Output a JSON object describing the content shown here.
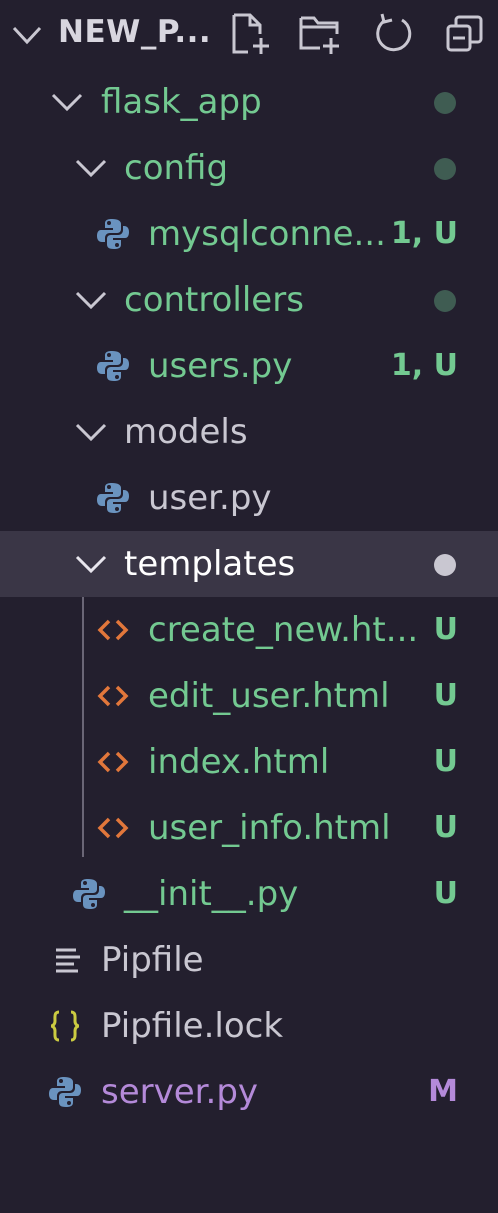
{
  "header": {
    "title": "NEW_P...",
    "actions": [
      "new-file-icon",
      "new-folder-icon",
      "refresh-icon",
      "collapse-all-icon"
    ]
  },
  "colors": {
    "untracked": "#73c991",
    "modified": "#b48ad9",
    "folder_default": "#c9c7d1",
    "python_icon": "#6a93bf",
    "html_icon": "#e2773b",
    "json_icon": "#cbcb41",
    "selection": "#3a3646"
  },
  "tree": [
    {
      "label": "flask_app",
      "type": "folder",
      "status": "",
      "dot": true
    },
    {
      "label": "config",
      "type": "folder",
      "status": "",
      "dot": true
    },
    {
      "label": "mysqlconne...",
      "type": "python",
      "status": "1, U",
      "dot": false
    },
    {
      "label": "controllers",
      "type": "folder",
      "status": "",
      "dot": true
    },
    {
      "label": "users.py",
      "type": "python",
      "status": "1, U",
      "dot": false
    },
    {
      "label": "models",
      "type": "folder",
      "status": "",
      "dot": false
    },
    {
      "label": "user.py",
      "type": "python",
      "status": "",
      "dot": false
    },
    {
      "label": "templates",
      "type": "folder",
      "status": "",
      "dot": true,
      "selected": true
    },
    {
      "label": "create_new.ht...",
      "type": "html",
      "status": "U",
      "dot": false
    },
    {
      "label": "edit_user.html",
      "type": "html",
      "status": "U",
      "dot": false
    },
    {
      "label": "index.html",
      "type": "html",
      "status": "U",
      "dot": false
    },
    {
      "label": "user_info.html",
      "type": "html",
      "status": "U",
      "dot": false
    },
    {
      "label": "__init__.py",
      "type": "python",
      "status": "U",
      "dot": false
    },
    {
      "label": "Pipfile",
      "type": "text",
      "status": "",
      "dot": false
    },
    {
      "label": "Pipfile.lock",
      "type": "json",
      "status": "",
      "dot": false
    },
    {
      "label": "server.py",
      "type": "python",
      "status": "M",
      "dot": false
    }
  ]
}
